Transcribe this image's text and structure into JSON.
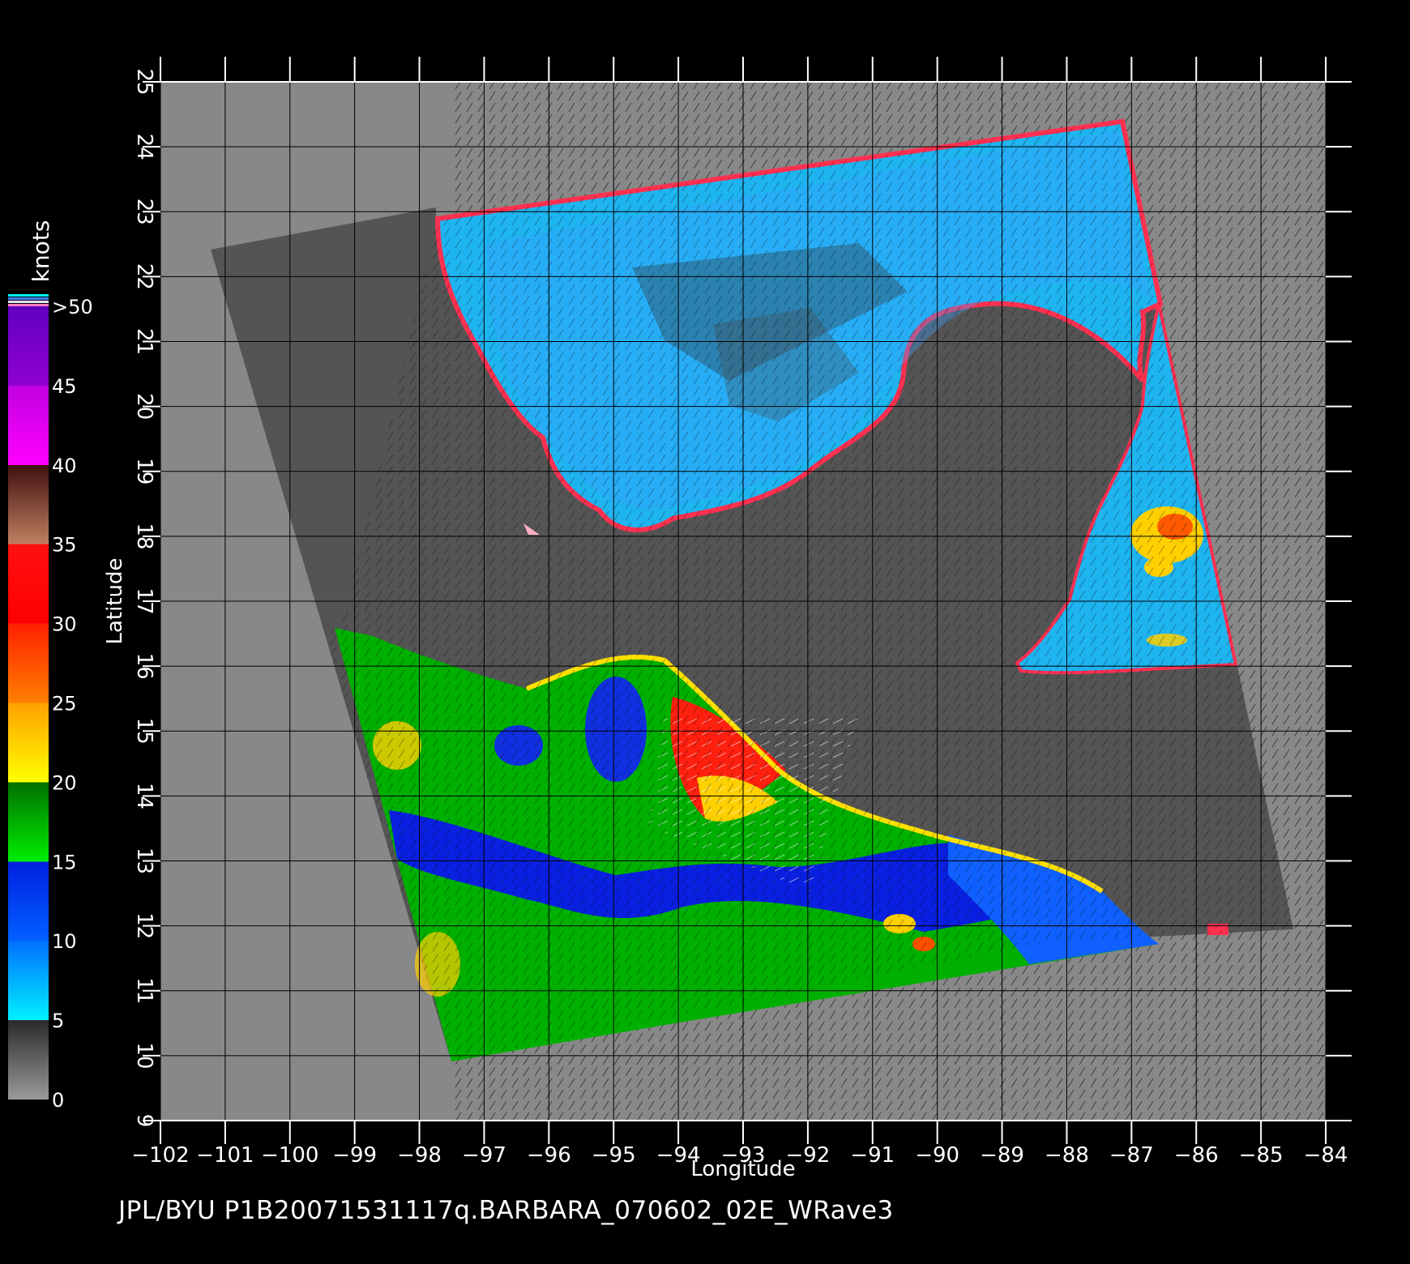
{
  "figure": {
    "xlabel": "Longitude",
    "ylabel": "Latitude",
    "caption": "JPL/BYU  P1B20071531117q.BARBARA_070602_02E_WRave3",
    "lon_range": [
      -102,
      -84
    ],
    "lat_range": [
      9,
      25
    ],
    "lon_ticks": [
      "−102",
      "−101",
      "−100",
      "−99",
      "−98",
      "−97",
      "−96",
      "−95",
      "−94",
      "−93",
      "−92",
      "−91",
      "−90",
      "−89",
      "−88",
      "−87",
      "−86",
      "−85",
      "−84"
    ],
    "lat_ticks": [
      "9",
      "10",
      "11",
      "12",
      "13",
      "14",
      "15",
      "16",
      "17",
      "18",
      "19",
      "20",
      "21",
      "22",
      "23",
      "24",
      "25"
    ]
  },
  "colorbar": {
    "unit": "knots",
    "labels": [
      ">50",
      "45",
      "40",
      "35",
      "30",
      "25",
      "20",
      "15",
      "10",
      "5",
      "0"
    ],
    "colors": {
      "0_5": "#4a4a4a",
      "5_10": "#00aaff",
      "10_15": "#0033ff",
      "15_20": "#00c000",
      "20_25": "#ffd000",
      "25_30": "#ff7000",
      "30_35": "#ff1010",
      "35_40": "#703020",
      "40_45": "#ff10ff",
      "45_50": "#8000e0"
    }
  },
  "map_colors": {
    "background": "#000000",
    "plot_area": "#888888",
    "swath_land": "#545454",
    "grid": "#000000"
  }
}
